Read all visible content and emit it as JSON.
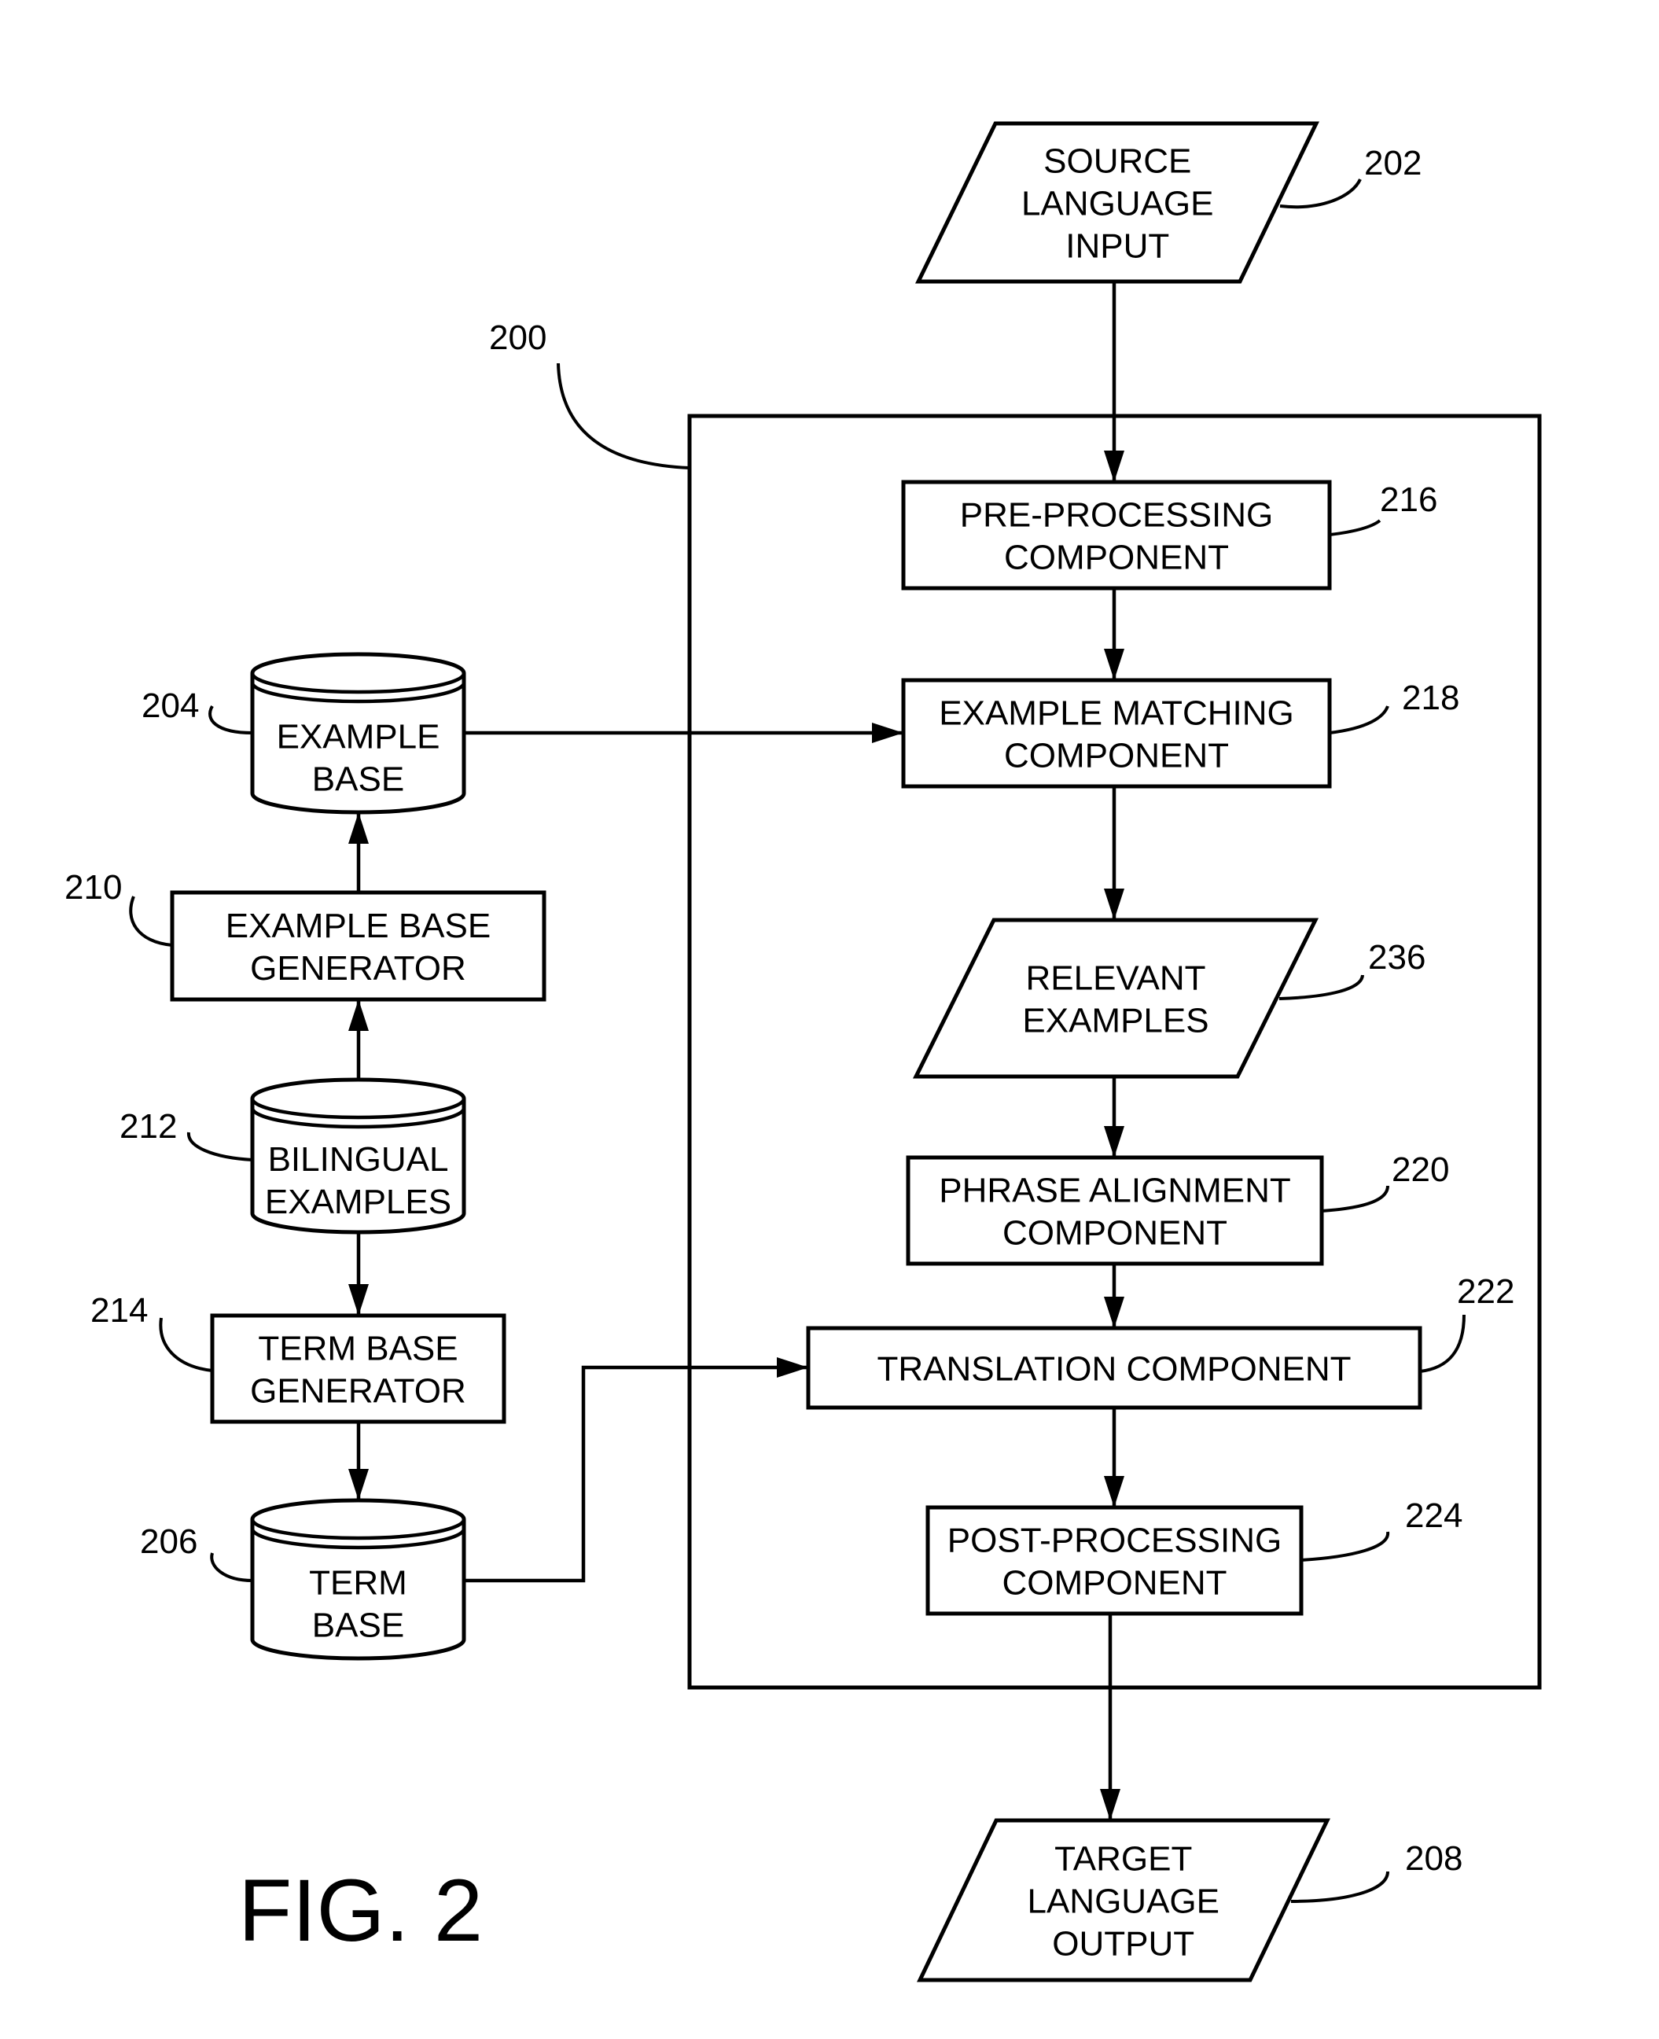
{
  "figure": {
    "caption": "FIG. 2",
    "system_ref": "200"
  },
  "nodes": {
    "source_input": {
      "ref": "202",
      "lines": [
        "SOURCE",
        "LANGUAGE",
        "INPUT"
      ],
      "shape": "parallelogram"
    },
    "pre_processing": {
      "ref": "216",
      "lines": [
        "PRE-PROCESSING",
        "COMPONENT"
      ],
      "shape": "rectangle"
    },
    "example_matching": {
      "ref": "218",
      "lines": [
        "EXAMPLE MATCHING",
        "COMPONENT"
      ],
      "shape": "rectangle"
    },
    "relevant_examples": {
      "ref": "236",
      "lines": [
        "RELEVANT",
        "EXAMPLES"
      ],
      "shape": "parallelogram"
    },
    "phrase_alignment": {
      "ref": "220",
      "lines": [
        "PHRASE ALIGNMENT",
        "COMPONENT"
      ],
      "shape": "rectangle"
    },
    "translation": {
      "ref": "222",
      "lines": [
        "TRANSLATION COMPONENT"
      ],
      "shape": "rectangle"
    },
    "post_processing": {
      "ref": "224",
      "lines": [
        "POST-PROCESSING",
        "COMPONENT"
      ],
      "shape": "rectangle"
    },
    "target_output": {
      "ref": "208",
      "lines": [
        "TARGET",
        "LANGUAGE",
        "OUTPUT"
      ],
      "shape": "parallelogram"
    },
    "example_base": {
      "ref": "204",
      "lines": [
        "EXAMPLE",
        "BASE"
      ],
      "shape": "cylinder"
    },
    "example_base_generator": {
      "ref": "210",
      "lines": [
        "EXAMPLE BASE",
        "GENERATOR"
      ],
      "shape": "rectangle"
    },
    "bilingual_examples": {
      "ref": "212",
      "lines": [
        "BILINGUAL",
        "EXAMPLES"
      ],
      "shape": "cylinder"
    },
    "term_base_generator": {
      "ref": "214",
      "lines": [
        "TERM BASE",
        "GENERATOR"
      ],
      "shape": "rectangle"
    },
    "term_base": {
      "ref": "206",
      "lines": [
        "TERM",
        "BASE"
      ],
      "shape": "cylinder"
    }
  },
  "edges": [
    {
      "from": "source_input",
      "to": "pre_processing"
    },
    {
      "from": "pre_processing",
      "to": "example_matching"
    },
    {
      "from": "example_base",
      "to": "example_matching"
    },
    {
      "from": "example_matching",
      "to": "relevant_examples"
    },
    {
      "from": "relevant_examples",
      "to": "phrase_alignment"
    },
    {
      "from": "phrase_alignment",
      "to": "translation"
    },
    {
      "from": "term_base",
      "to": "translation"
    },
    {
      "from": "translation",
      "to": "post_processing"
    },
    {
      "from": "post_processing",
      "to": "target_output"
    },
    {
      "from": "example_base_generator",
      "to": "example_base"
    },
    {
      "from": "bilingual_examples",
      "to": "example_base_generator"
    },
    {
      "from": "bilingual_examples",
      "to": "term_base_generator"
    },
    {
      "from": "term_base_generator",
      "to": "term_base"
    }
  ]
}
